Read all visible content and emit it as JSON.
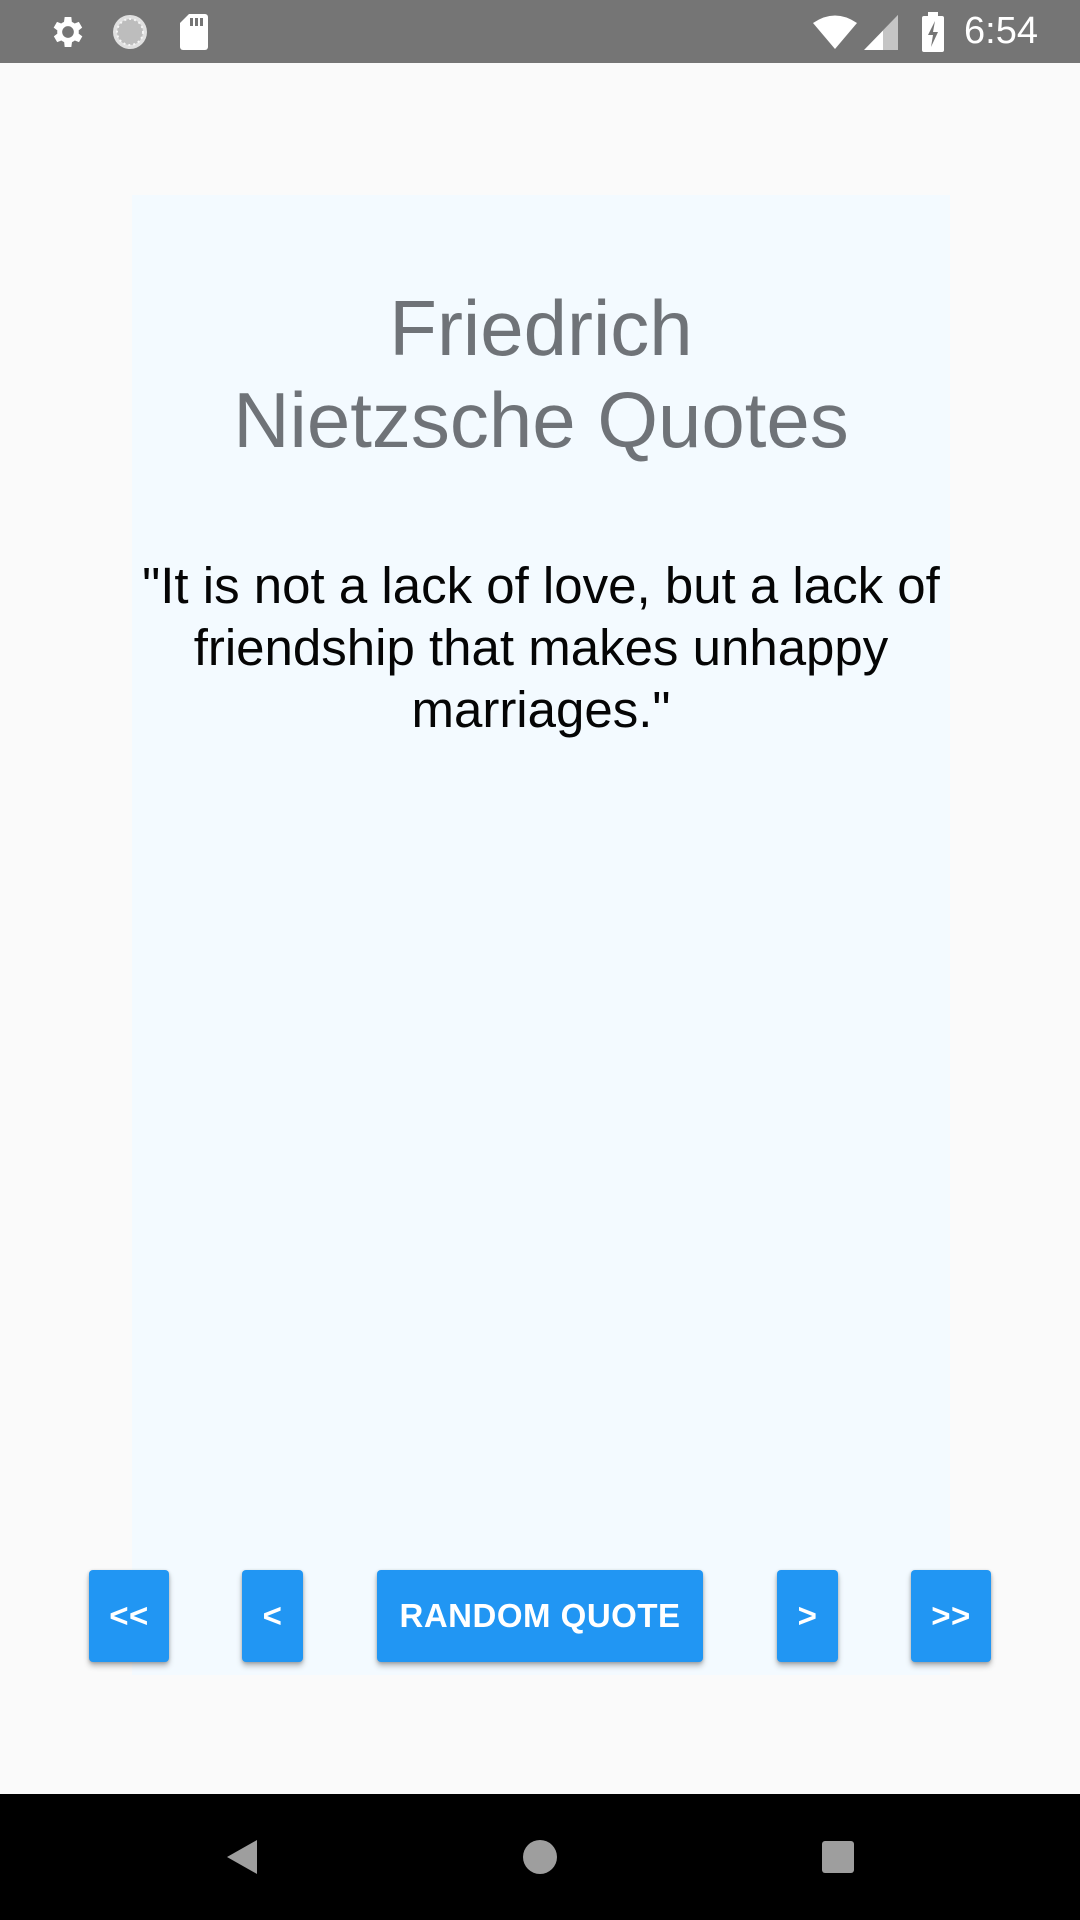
{
  "status_bar": {
    "time": "6:54",
    "icons": [
      "gear-icon",
      "loading-circle-icon",
      "sd-card-icon",
      "wifi-icon",
      "cell-signal-icon",
      "battery-charging-icon"
    ],
    "background": "#757575"
  },
  "app": {
    "title": "Friedrich\nNietzsche Quotes",
    "quote": "\"It is not a lack of love, but a lack of friendship that makes unhappy marriages.\""
  },
  "controls": {
    "first_label": "<<",
    "prev_label": "<",
    "random_label": "RANDOM QUOTE",
    "next_label": ">",
    "last_label": ">>",
    "button_color": "#2196f3"
  },
  "nav_bar": {
    "icons": [
      "back-triangle-icon",
      "home-circle-icon",
      "recents-square-icon"
    ]
  }
}
